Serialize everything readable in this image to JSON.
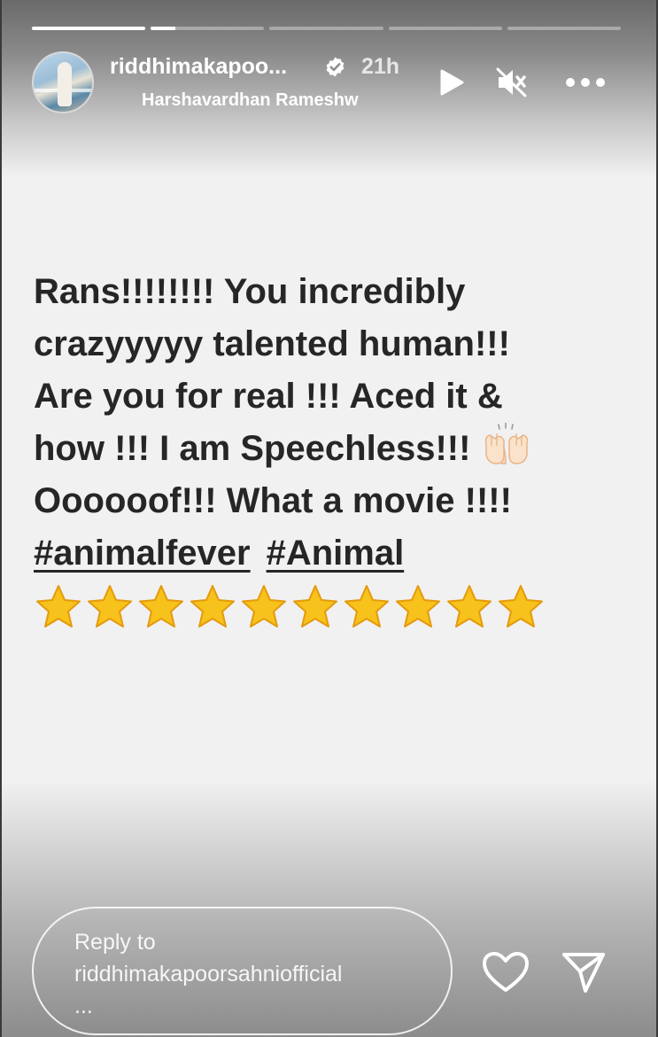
{
  "progress": [
    1,
    0.22,
    0,
    0,
    0
  ],
  "header": {
    "username": "riddhimakapoo...",
    "time": "21h",
    "music": "Harshavardhan Rameshw"
  },
  "caption": {
    "lines": [
      "Rans!!!!!!!! You incredibly",
      "crazyyyyy talented human!!!",
      "Are you for real !!! Aced it &",
      "how !!! I am Speechless!!!",
      "Oooooof!!! What a movie !!!!"
    ],
    "hashtags": [
      "#animalfever",
      "#Animal"
    ],
    "star_count": 10
  },
  "reply": {
    "line1": "Reply to",
    "line2": "riddhimakapoorsahniofficial",
    "line3": "..."
  },
  "icons": {
    "verified": "verified-badge-icon",
    "play": "play-icon",
    "mute": "mute-icon",
    "more": "more-options-icon",
    "heart": "heart-icon",
    "send": "send-icon",
    "raised_hands": "raised-hands-emoji",
    "star": "star-emoji"
  },
  "colors": {
    "text": "#262626",
    "background": "#f1f1f2",
    "star": "#f7c21b"
  }
}
